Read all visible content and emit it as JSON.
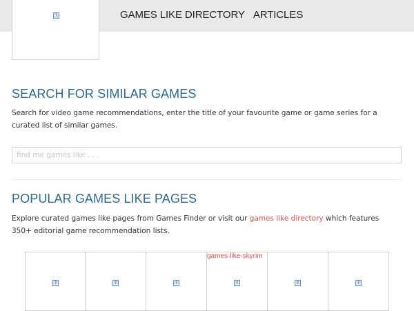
{
  "header": {
    "logo_icon": "broken-image-icon",
    "nav": [
      {
        "label": "GAMES LIKE DIRECTORY"
      },
      {
        "label": "ARTICLES"
      }
    ]
  },
  "search_section": {
    "title": "SEARCH FOR SIMILAR GAMES",
    "description": "Search for video game recommendations, enter the title of your favourite game or game series for a curated list of similar games.",
    "input_placeholder": "find me games like . . .",
    "input_value": ""
  },
  "popular_section": {
    "title": "POPULAR GAMES LIKE PAGES",
    "description_before": "Explore curated games like pages from Games Finder or visit our ",
    "description_link": "games like directory",
    "description_after": " which features 350+ editorial game recommendation lists.",
    "tiles": [
      {
        "label": ""
      },
      {
        "label": ""
      },
      {
        "label": ""
      },
      {
        "label": "games-like-skyrim"
      },
      {
        "label": ""
      },
      {
        "label": ""
      }
    ]
  },
  "colors": {
    "header_bg": "#e9e9e9",
    "heading": "#2e6a90",
    "link": "#d9534f"
  }
}
